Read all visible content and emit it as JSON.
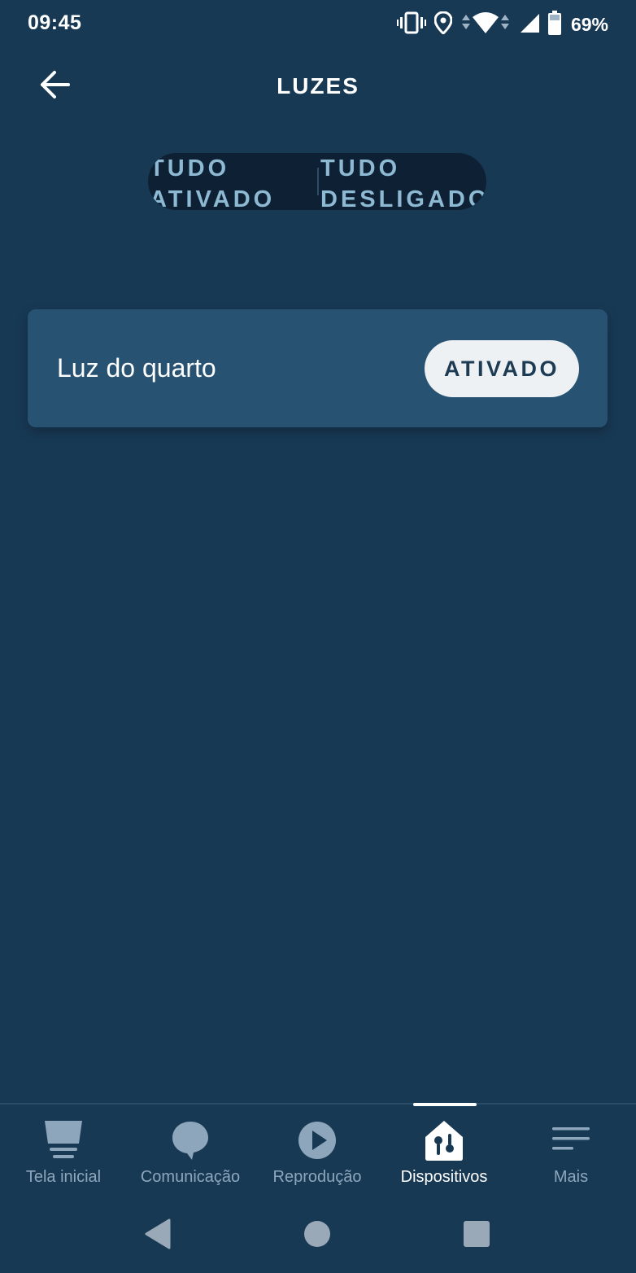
{
  "status_bar": {
    "time": "09:45",
    "battery_percent": "69%",
    "icons": [
      "vibrate-icon",
      "location-icon",
      "wifi-icon",
      "cellular-signal-icon",
      "battery-icon"
    ]
  },
  "header": {
    "title": "LUZES",
    "back_icon": "arrow-left-icon"
  },
  "group_toggle": {
    "all_on_label": "TUDO\nATIVADO",
    "all_off_label": "TUDO\nDESLIGADO"
  },
  "devices": [
    {
      "name": "Luz do quarto",
      "state_label": "ATIVADO"
    }
  ],
  "bottom_nav": {
    "items": [
      {
        "label": "Tela inicial",
        "icon": "home-screen-icon",
        "active": false
      },
      {
        "label": "Comunicação",
        "icon": "chat-bubble-icon",
        "active": false
      },
      {
        "label": "Reprodução",
        "icon": "play-icon",
        "active": false
      },
      {
        "label": "Dispositivos",
        "icon": "devices-house-icon",
        "active": true
      },
      {
        "label": "Mais",
        "icon": "menu-lines-icon",
        "active": false
      }
    ]
  },
  "system_nav": {
    "icons": [
      "back-triangle-icon",
      "home-circle-icon",
      "recents-square-icon"
    ]
  },
  "colors": {
    "background": "#183954",
    "card": "#275272",
    "toggle_group_bg": "#0e2134",
    "toggle_text": "#8eb9d2",
    "nav_inactive": "#8da6bc",
    "nav_active": "#ffffff"
  }
}
